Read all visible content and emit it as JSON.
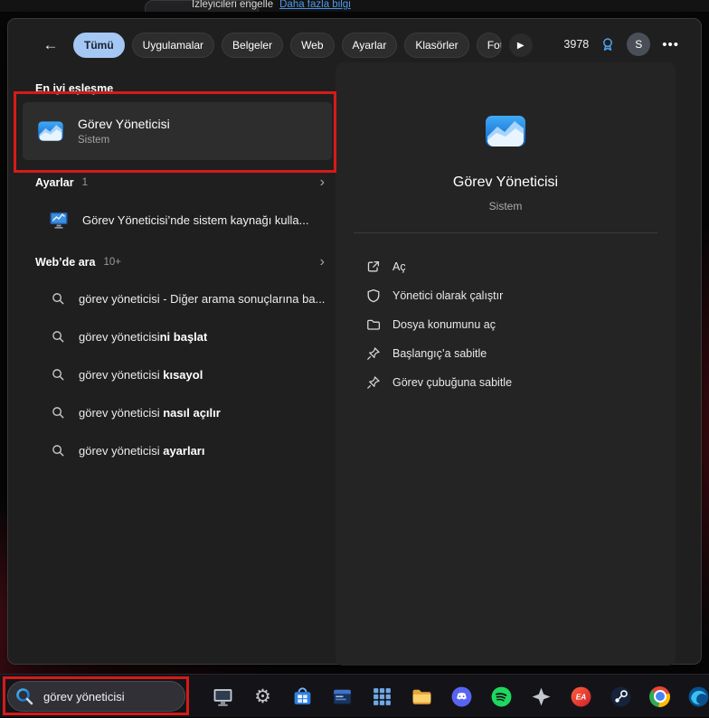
{
  "browser_strip": {
    "text": "İzleyicileri engelle",
    "link": "Daha fazla bilgi"
  },
  "glyphs": {
    "back": "←",
    "play": "▶",
    "chevron": "›",
    "more": "•••",
    "gear": "⚙"
  },
  "search": {
    "tabs": [
      {
        "label": "Tümü"
      },
      {
        "label": "Uygulamalar"
      },
      {
        "label": "Belgeler"
      },
      {
        "label": "Web"
      },
      {
        "label": "Ayarlar"
      },
      {
        "label": "Klasörler"
      },
      {
        "label": "Fotoğraflar"
      }
    ],
    "rewards_points": "3978",
    "avatar_initial": "S",
    "best_match_heading": "En iyi eşleşme",
    "best_match": {
      "title": "Görev Yöneticisi",
      "subtitle": "Sistem"
    },
    "settings_section": {
      "title": "Ayarlar",
      "count": "1",
      "item": "Görev Yöneticisi’nde sistem kaynağı kulla..."
    },
    "web_section": {
      "title": "Web’de ara",
      "count": "10+"
    },
    "web_suggestions": [
      {
        "typed": "görev yöneticisi",
        "rest": " - Diğer arama sonuçlarına ba..."
      },
      {
        "typed": "görev yöneticisi",
        "rest": "ni başlat"
      },
      {
        "typed": "görev yöneticisi",
        "rest": " kısayol"
      },
      {
        "typed": "görev yöneticisi",
        "rest": " nasıl açılır"
      },
      {
        "typed": "görev yöneticisi",
        "rest": " ayarları"
      }
    ],
    "detail": {
      "title": "Görev Yöneticisi",
      "subtitle": "Sistem",
      "actions": [
        {
          "label": "Aç"
        },
        {
          "label": "Yönetici olarak çalıştır"
        },
        {
          "label": "Dosya konumunu aç"
        },
        {
          "label": "Başlangıç’a sabitle"
        },
        {
          "label": "Görev çubuğuna sabitle"
        }
      ]
    }
  },
  "taskbar": {
    "search_value": "görev yöneticisi",
    "ea_label": "EA"
  }
}
